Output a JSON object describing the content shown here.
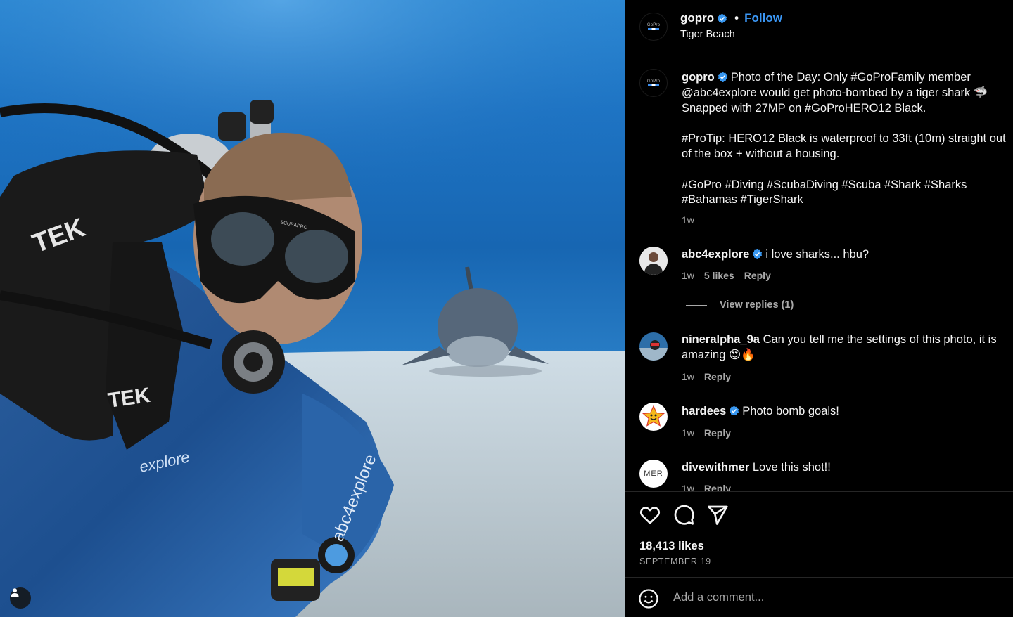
{
  "header": {
    "username": "gopro",
    "separator": "•",
    "follow_label": "Follow",
    "location": "Tiger Beach",
    "avatar_text": "GoPro"
  },
  "caption": {
    "username": "gopro",
    "paragraphs": [
      "Photo of the Day: Only #GoProFamily member @abc4explore would get photo-bombed by a tiger shark 🦈 Snapped with 27MP on #GoProHERO12 Black.",
      "#ProTip: HERO12 Black is waterproof to 33ft (10m) straight out of the box + without a housing.",
      "#GoPro #Diving #ScubaDiving #Scuba #Shark #Sharks #Bahamas #TigerShark"
    ],
    "time": "1w"
  },
  "comments": [
    {
      "username": "abc4explore",
      "verified": true,
      "text": "i love sharks... hbu?",
      "time": "1w",
      "likes": "5 likes",
      "reply_label": "Reply",
      "view_replies": "View replies (1)",
      "avatar_icon": "person-avatar"
    },
    {
      "username": "nineralpha_9a",
      "verified": false,
      "text": "Can you tell me the settings of this photo, it is amazing 😍🔥",
      "time": "1w",
      "reply_label": "Reply",
      "avatar_icon": "diver-avatar"
    },
    {
      "username": "hardees",
      "verified": true,
      "text": "Photo bomb goals!",
      "time": "1w",
      "reply_label": "Reply",
      "avatar_icon": "star-avatar"
    },
    {
      "username": "divewithmer",
      "verified": false,
      "text": "Love this shot!!",
      "time": "1w",
      "reply_label": "Reply",
      "avatar_text": "MER"
    }
  ],
  "actions": {
    "like_icon": "heart-icon",
    "comment_icon": "comment-icon",
    "share_icon": "share-icon",
    "likes_count": "18,413 likes",
    "date": "SEPTEMBER 19"
  },
  "add_comment": {
    "placeholder": "Add a comment...",
    "emoji_icon": "emoji-icon"
  },
  "photo": {
    "tag_icon": "user-tag-icon",
    "mask_text": "SCUBAPRO",
    "suit_texts": [
      "TEK",
      "TEK",
      "explore",
      "abc4explore"
    ]
  },
  "colors": {
    "accent": "#3b97f5",
    "background": "#000000",
    "muted": "#a8a8a8",
    "verified": "#3897f0"
  }
}
